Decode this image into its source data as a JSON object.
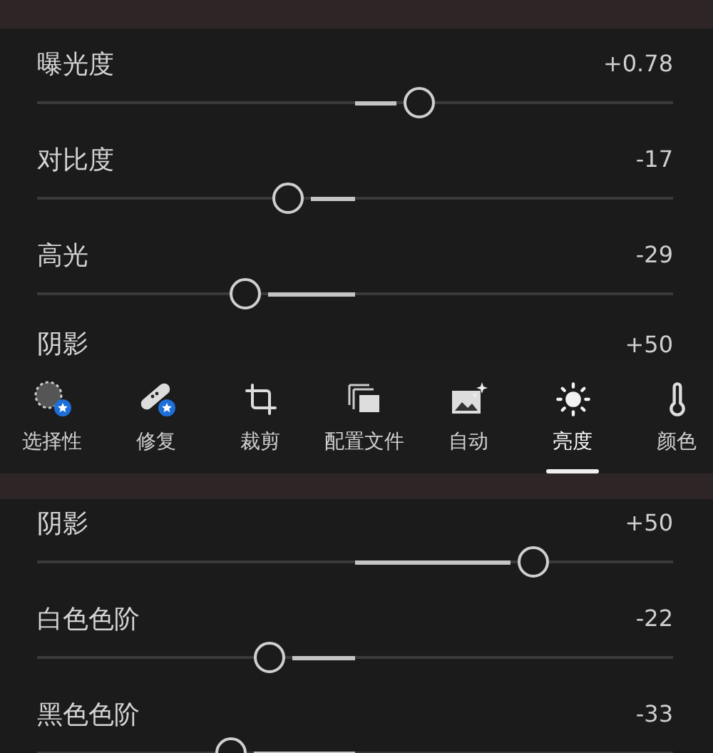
{
  "top_panel": {
    "sliders": [
      {
        "label": "曝光度",
        "value": "+0.78",
        "level": 0.6
      },
      {
        "label": "对比度",
        "value": "-17",
        "level": 0.395
      },
      {
        "label": "高光",
        "value": "-29",
        "level": 0.327
      }
    ],
    "cut_row": {
      "label": "阴影",
      "value": "+50"
    }
  },
  "toolbar": {
    "tools": [
      {
        "kind": "selective",
        "label": "选择性",
        "badge": true,
        "selected": false
      },
      {
        "kind": "healing",
        "label": "修复",
        "badge": true,
        "selected": false
      },
      {
        "kind": "crop",
        "label": "裁剪",
        "badge": false,
        "selected": false
      },
      {
        "kind": "profiles",
        "label": "配置文件",
        "badge": false,
        "selected": false
      }
    ],
    "adjustments": [
      {
        "kind": "auto",
        "label": "自动",
        "selected": false
      },
      {
        "kind": "light",
        "label": "亮度",
        "selected": true
      },
      {
        "kind": "color",
        "label": "颜色",
        "selected": false
      }
    ]
  },
  "bottom_panel": {
    "sliders": [
      {
        "label": "阴影",
        "value": "+50",
        "level": 0.78
      },
      {
        "label": "白色色阶",
        "value": "-22",
        "level": 0.365
      },
      {
        "label": "黑色色阶",
        "value": "-33",
        "level": 0.305
      }
    ]
  }
}
